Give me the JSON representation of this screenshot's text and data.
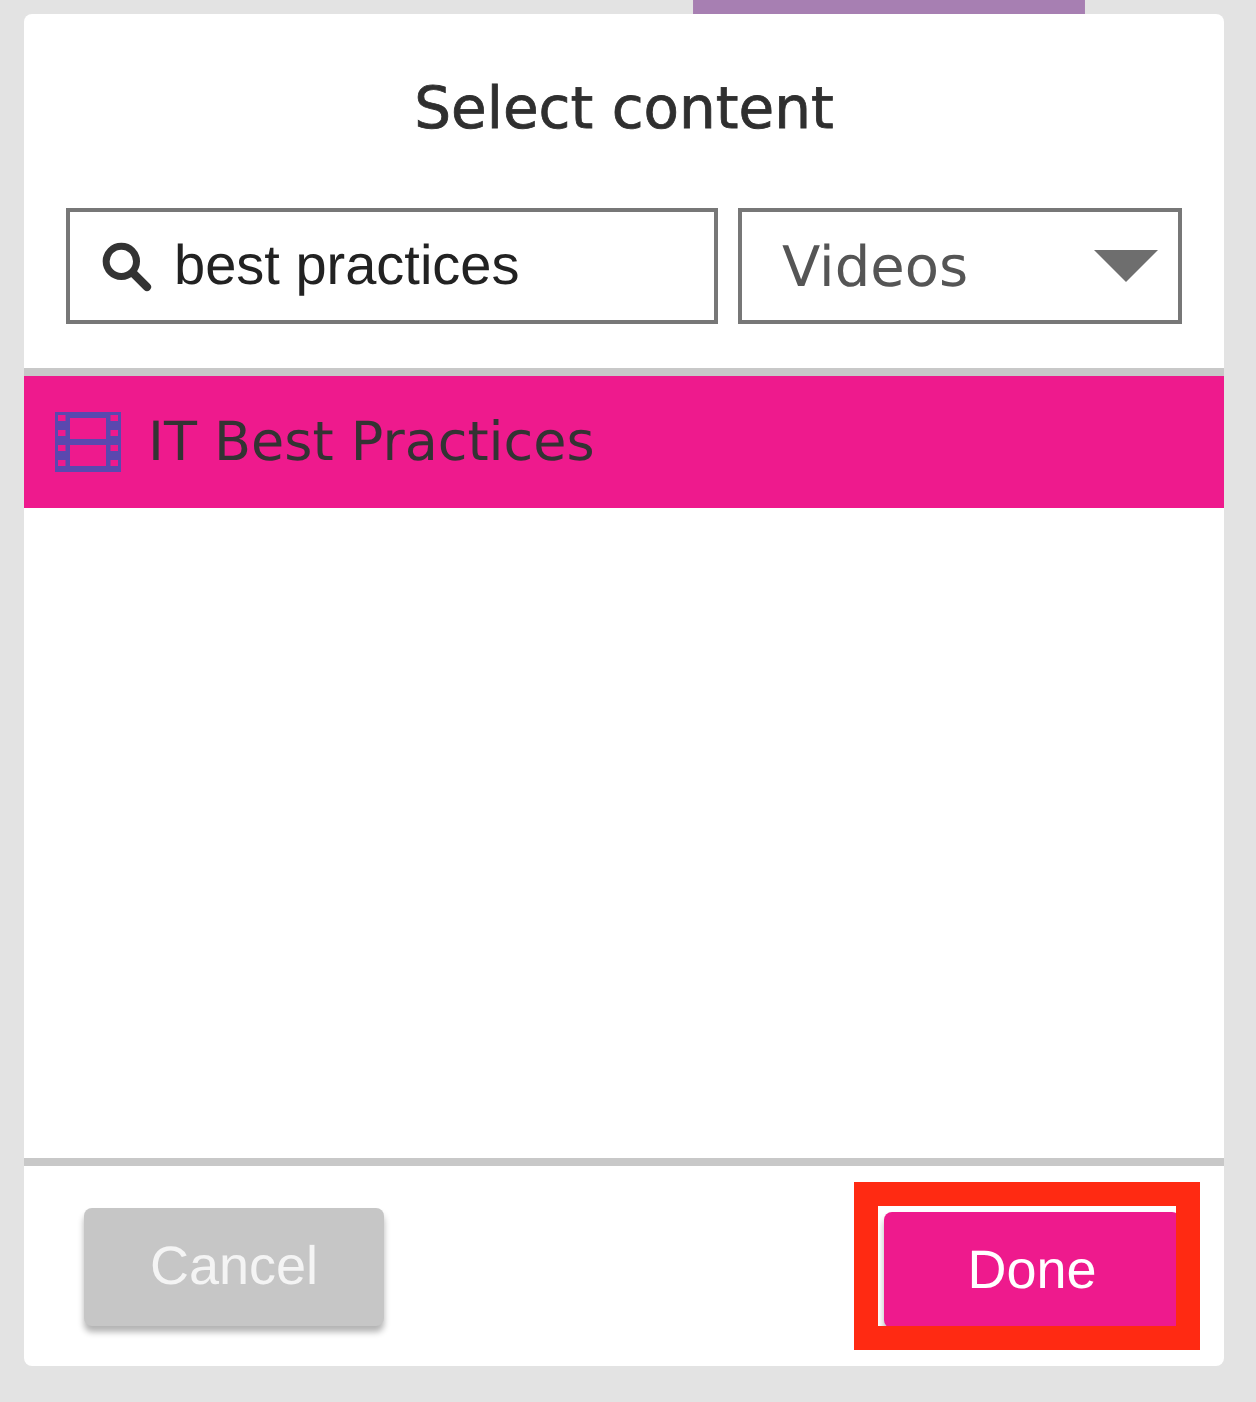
{
  "dialog": {
    "title": "Select content",
    "search": {
      "value": "best practices"
    },
    "filter": {
      "value": "Videos"
    },
    "results": [
      {
        "label": "IT Best Practices",
        "kind": "video",
        "selected": true
      }
    ],
    "buttons": [
      {
        "label": "Cancel",
        "kind": "secondary",
        "highlighted": false
      },
      {
        "label": "Done",
        "kind": "primary",
        "highlighted": true
      }
    ]
  }
}
